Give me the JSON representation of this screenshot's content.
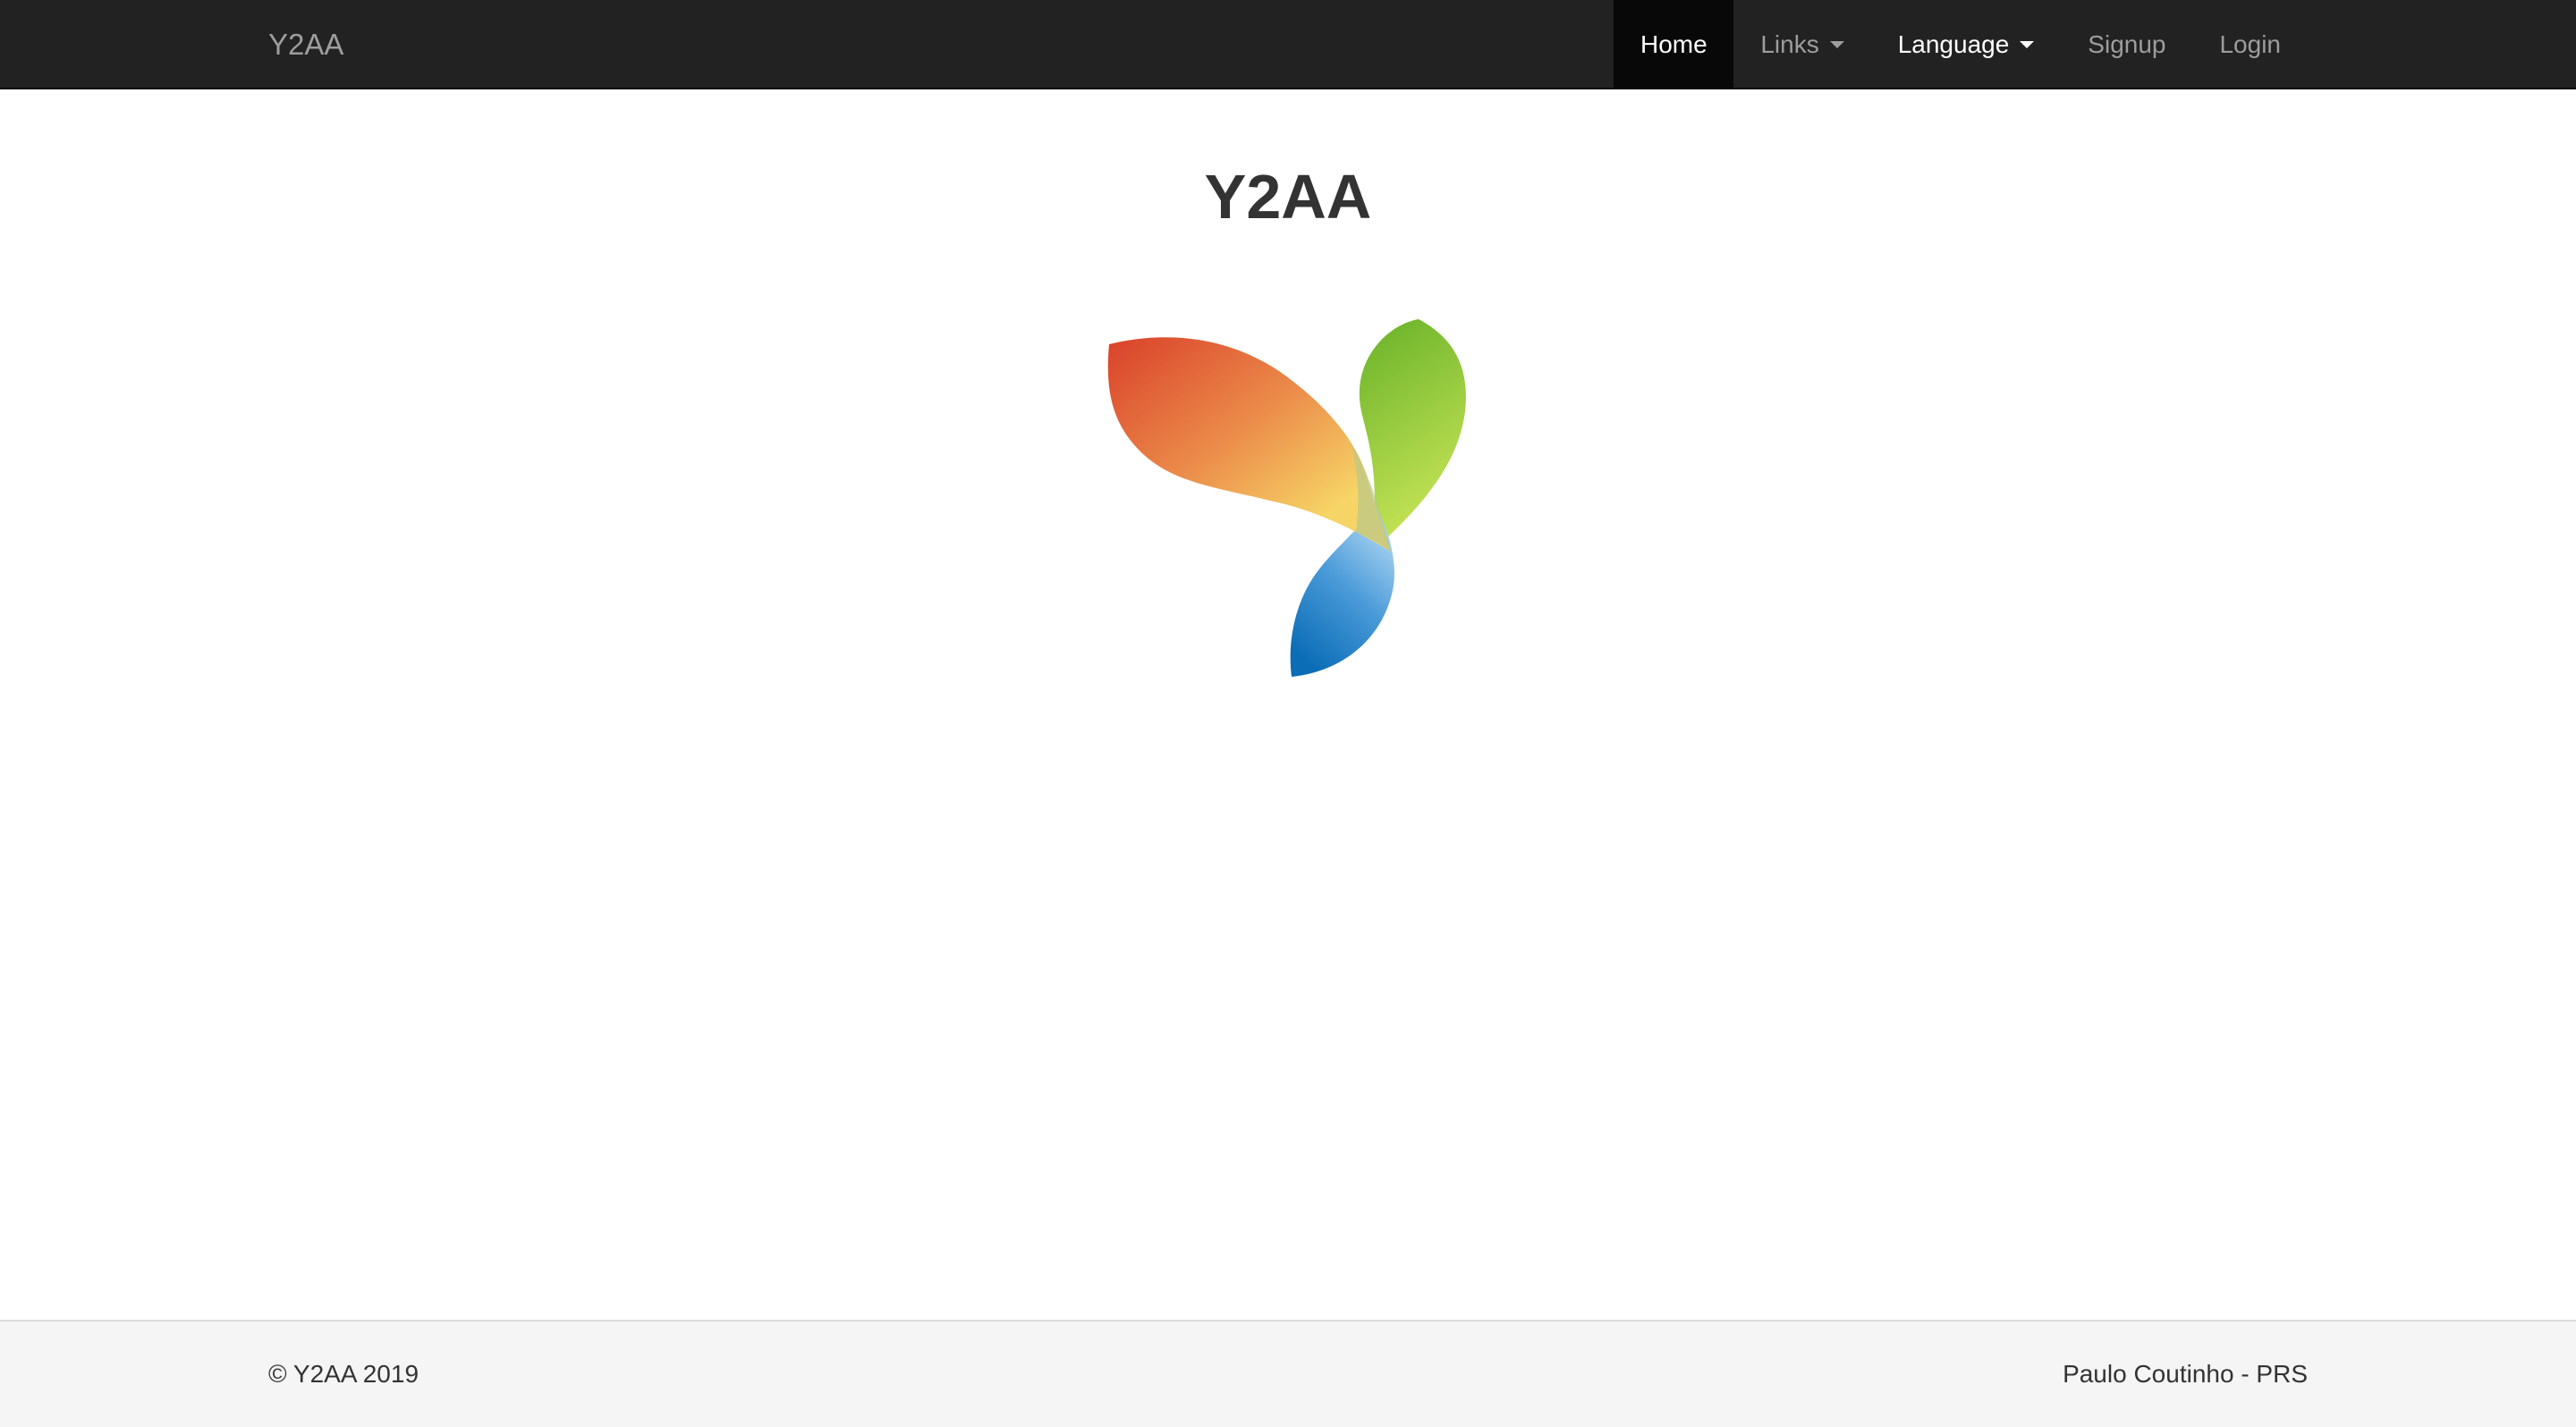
{
  "navbar": {
    "brand": "Y2AA",
    "items": [
      {
        "label": "Home",
        "active": true
      },
      {
        "label": "Links",
        "dropdown": true
      },
      {
        "label": "Language",
        "dropdown": true
      },
      {
        "label": "Signup"
      },
      {
        "label": "Login"
      }
    ]
  },
  "main": {
    "title": "Y2AA",
    "logo": "yii-framework-logo"
  },
  "footer": {
    "copyright": "© Y2AA 2019",
    "credit": "Paulo Coutinho - PRS"
  },
  "colors": {
    "navbar_bg": "#222222",
    "navbar_active_bg": "#080808",
    "navbar_text": "#9d9d9d",
    "footer_bg": "#f5f5f5"
  }
}
